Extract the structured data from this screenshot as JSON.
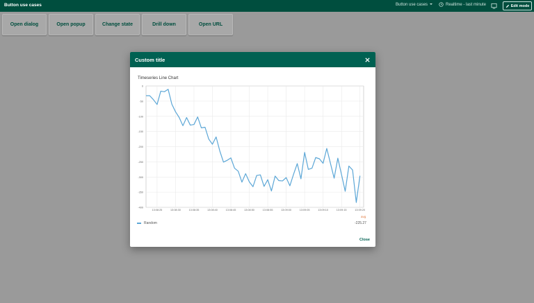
{
  "topbar": {
    "title": "Button use cases",
    "dashboard_select": "Button use cases",
    "realtime": "Realtime - last minute",
    "edit_mode": "Edit mode"
  },
  "buttons": [
    "Open dialog",
    "Open popup",
    "Change state",
    "Drill down",
    "Open URL"
  ],
  "dialog": {
    "title": "Custom title",
    "close_label": "Close"
  },
  "chart_data": {
    "type": "line",
    "title": "Timeseries Line Chart",
    "xlabel": "",
    "ylabel": "",
    "ylim": [
      -400,
      0
    ],
    "yticks": [
      0,
      -50,
      -100,
      -150,
      -200,
      -250,
      -300,
      -350,
      -400
    ],
    "xtick_labels": [
      "13:08:25",
      "13:08:30",
      "13:08:35",
      "13:08:40",
      "13:08:45",
      "13:08:50",
      "13:08:55",
      "13:09:00",
      "13:09:05",
      "13:09:10",
      "13:09:15",
      "13:09:20"
    ],
    "xticks_t": [
      3,
      8,
      13,
      18,
      23,
      28,
      33,
      38,
      43,
      48,
      53,
      58
    ],
    "xlim": [
      0,
      59
    ],
    "grid": true,
    "legend_position": "bottom",
    "legend_header": "avg",
    "series": [
      {
        "name": "Random",
        "color": "#5ba6d6",
        "avg_label": "-225.27",
        "t": [
          0,
          1,
          2,
          3,
          4,
          5,
          6,
          7,
          8,
          9,
          10,
          11,
          12,
          13,
          14,
          15,
          16,
          17,
          18,
          19,
          20,
          21,
          22,
          23,
          24,
          25,
          26,
          27,
          28,
          29,
          30,
          31,
          32,
          33,
          34,
          35,
          36,
          37,
          38,
          39,
          40,
          41,
          42,
          43,
          44,
          45,
          46,
          47,
          48,
          49,
          50,
          51,
          52,
          53,
          54,
          55,
          56,
          57,
          58,
          59
        ],
        "values": [
          -32,
          -32,
          -45,
          -61,
          -17,
          -19,
          -11,
          -60,
          -85,
          -104,
          -131,
          -104,
          -129,
          -127,
          -102,
          -138,
          -136,
          -175,
          -192,
          -168,
          -214,
          -251,
          -245,
          -237,
          -271,
          -281,
          -317,
          -289,
          -316,
          -332,
          -295,
          -293,
          -331,
          -309,
          -346,
          -297,
          -312,
          -313,
          -302,
          -329,
          -291,
          -256,
          -306,
          -219,
          -275,
          -271,
          -236,
          -240,
          -255,
          -206,
          -255,
          -304,
          -238,
          -292,
          -347,
          -264,
          -277,
          -384,
          -296
        ]
      }
    ]
  },
  "colors": {
    "topbar": "#004e3e",
    "dialog_header": "#006152",
    "series": "#5ba6d6",
    "accent": "#e07a3f"
  }
}
